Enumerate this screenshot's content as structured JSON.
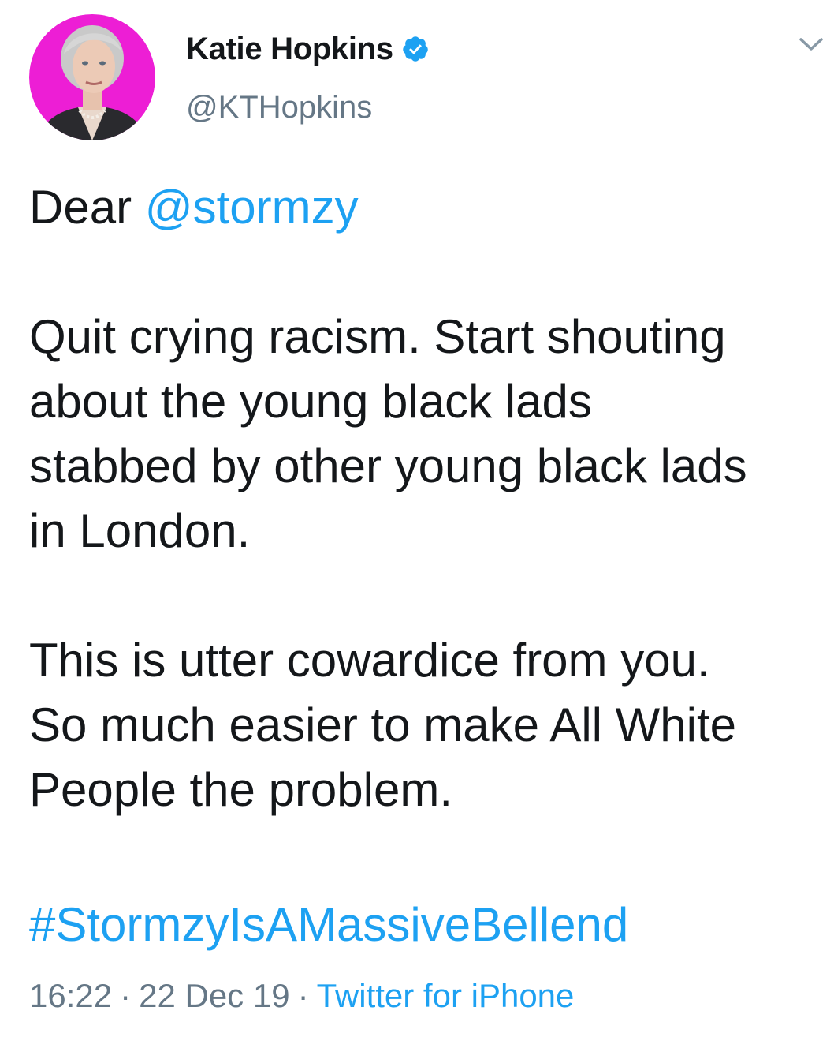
{
  "author": {
    "display_name": "Katie Hopkins",
    "handle": "@KTHopkins",
    "verified": true,
    "avatar_ring_color": "#ff1fd6"
  },
  "tweet": {
    "greeting": "Dear ",
    "mention": "@stormzy",
    "paragraph1": [
      "Quit crying racism. Start shouting",
      "about the young black lads",
      "stabbed by other young black lads",
      "in London."
    ],
    "paragraph2": [
      "This is utter cowardice from you.",
      "So much easier to make All White",
      "People the problem."
    ],
    "hashtag": "#StormzyIsAMassiveBellend"
  },
  "meta": {
    "time": "16:22",
    "separator": "·",
    "date": "22 Dec 19",
    "source": "Twitter for iPhone"
  },
  "colors": {
    "link": "#1da1f2",
    "secondary": "#657786",
    "text": "#14171a"
  },
  "icons": {
    "verified": "verified-badge-icon",
    "menu": "chevron-down-icon"
  }
}
